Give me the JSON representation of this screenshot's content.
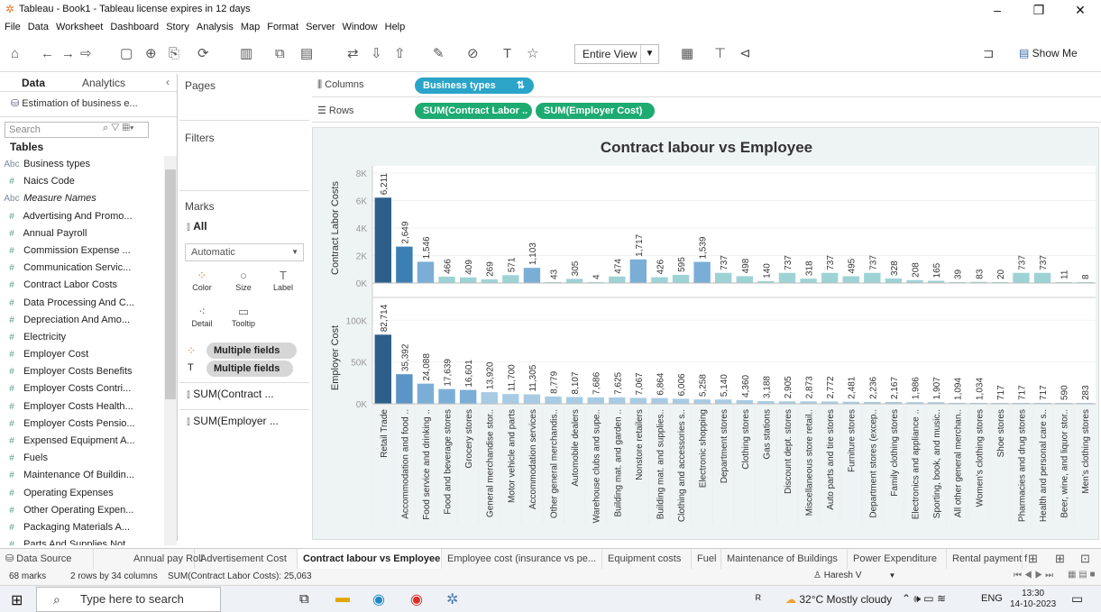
{
  "window": {
    "title": "Tableau - Book1 - Tableau license expires in 12 days"
  },
  "menu": [
    "File",
    "Data",
    "Worksheet",
    "Dashboard",
    "Story",
    "Analysis",
    "Map",
    "Format",
    "Server",
    "Window",
    "Help"
  ],
  "toolbar": {
    "fit": "Entire View",
    "show_me": "Show Me"
  },
  "data_pane": {
    "tab_data": "Data",
    "tab_analytics": "Analytics",
    "datasource": "Estimation of business e...",
    "search_placeholder": "Search",
    "tables_label": "Tables",
    "fields": [
      {
        "type": "Abc",
        "name": "Business types"
      },
      {
        "type": "#",
        "name": "Naics Code"
      },
      {
        "type": "Abc",
        "name": "Measure Names"
      },
      {
        "type": "#",
        "name": "Advertising And Promo..."
      },
      {
        "type": "#",
        "name": "Annual Payroll"
      },
      {
        "type": "#",
        "name": "Commission Expense ..."
      },
      {
        "type": "#",
        "name": "Communication Servic..."
      },
      {
        "type": "#",
        "name": "Contract Labor Costs"
      },
      {
        "type": "#",
        "name": "Data Processing And C..."
      },
      {
        "type": "#",
        "name": "Depreciation And Amo..."
      },
      {
        "type": "#",
        "name": "Electricity"
      },
      {
        "type": "#",
        "name": "Employer Cost"
      },
      {
        "type": "#",
        "name": "Employer Costs Benefits"
      },
      {
        "type": "#",
        "name": "Employer Costs Contri..."
      },
      {
        "type": "#",
        "name": "Employer Costs Health..."
      },
      {
        "type": "#",
        "name": "Employer Costs Pensio..."
      },
      {
        "type": "#",
        "name": "Expensed Equipment A..."
      },
      {
        "type": "#",
        "name": "Fuels"
      },
      {
        "type": "#",
        "name": "Maintenance Of Buildin..."
      },
      {
        "type": "#",
        "name": "Operating Expenses"
      },
      {
        "type": "#",
        "name": "Other Operating Expen..."
      },
      {
        "type": "#",
        "name": "Packaging Materials A..."
      },
      {
        "type": "#",
        "name": "Parts And Supplies Not..."
      }
    ]
  },
  "cards": {
    "pages": "Pages",
    "filters": "Filters",
    "marks": "Marks",
    "all": "All",
    "mark_type": "Automatic",
    "color": "Color",
    "size": "Size",
    "label": "Label",
    "detail": "Detail",
    "tooltip": "Tooltip",
    "multi1": "Multiple fields",
    "multi2": "Multiple fields",
    "sum1": "SUM(Contract ...",
    "sum2": "SUM(Employer ..."
  },
  "shelves": {
    "columns_label": "Columns",
    "rows_label": "Rows",
    "columns_pill": "Business types",
    "rows_pill1": "SUM(Contract Labor ..",
    "rows_pill2": "SUM(Employer Cost)"
  },
  "chart_data": {
    "type": "bar",
    "title": "Contract labour vs Employee",
    "categories": [
      "Retail Trade",
      "Accommodation and food ..",
      "Food service and drinking ..",
      "Food and beverage stores",
      "Grocery stores",
      "General merchandise stor..",
      "Motor vehicle and parts",
      "Accommodation services",
      "Other general merchandis..",
      "Automobile dealers",
      "Warehouse clubs and supe..",
      "Building mat. and garden ..",
      "Nonstore retailers",
      "Building mat. and supplies..",
      "Clothing and accessories s..",
      "Electronic shopping",
      "Department stores",
      "Clothing stores",
      "Gas stations",
      "Discount dept. stores",
      "Miscellaneous store retail..",
      "Auto parts and tire stores",
      "Furniture stores",
      "Department stores (excep..",
      "Family clothing stores",
      "Electronics and appliance ..",
      "Sporting, book, and music..",
      "All other general merchan..",
      "Women's clothing stores",
      "Shoe stores",
      "Pharmacies and drug stores",
      "Health and personal care s..",
      "Beer, wine, and liquor stor..",
      "Men's clothing stores"
    ],
    "series": [
      {
        "name": "Contract Labor Costs",
        "ylabel": "Contract Labor Costs",
        "ticks": [
          "8K",
          "6K",
          "4K",
          "2K",
          "0K"
        ],
        "ylim": [
          0,
          8000
        ],
        "values": [
          6211,
          2649,
          1546,
          466,
          409,
          269,
          571,
          1103,
          43,
          305,
          4,
          474,
          1717,
          426,
          595,
          1539,
          737,
          498,
          140,
          737,
          318,
          737,
          495,
          737,
          328,
          208,
          165,
          39,
          83,
          20,
          737,
          737,
          11,
          8
        ],
        "labels": [
          "6,211",
          "2,649",
          "1,546",
          "466",
          "409",
          "269",
          "571",
          "1,103",
          "43",
          "305",
          "4",
          "474",
          "1,717",
          "426",
          "595",
          "1,539",
          "737",
          "498",
          "140",
          "737",
          "318",
          "737",
          "495",
          "737",
          "328",
          "208",
          "165",
          "39",
          "83",
          "20",
          "737",
          "737",
          "11",
          "8"
        ]
      },
      {
        "name": "Employer Cost",
        "ylabel": "Employer Cost",
        "ticks": [
          "100K",
          "50K",
          "0K"
        ],
        "ylim": [
          0,
          110000
        ],
        "values": [
          82714,
          35392,
          24088,
          17639,
          16601,
          13920,
          11700,
          11305,
          8779,
          8107,
          7686,
          7625,
          7067,
          6864,
          6006,
          5258,
          5140,
          4360,
          3188,
          2905,
          2873,
          2772,
          2481,
          2236,
          2167,
          1986,
          1907,
          1094,
          1034,
          717,
          717,
          717,
          590,
          283
        ],
        "labels": [
          "82,714",
          "35,392",
          "24,088",
          "17,639",
          "16,601",
          "13,920",
          "11,700",
          "11,305",
          "8,779",
          "8,107",
          "7,686",
          "7,625",
          "7,067",
          "6,864",
          "6,006",
          "5,258",
          "5,140",
          "4,360",
          "3,188",
          "2,905",
          "2,873",
          "2,772",
          "2,481",
          "2,236",
          "2,167",
          "1,986",
          "1,907",
          "1,094",
          "1,034",
          "717",
          "717",
          "717",
          "590",
          "283"
        ]
      }
    ],
    "colors": {
      "dark": "#2e5f8a",
      "mid": "#7aaed6",
      "light": "#9ed3d6"
    }
  },
  "sheet_tabs": [
    "Data Source",
    "Annual pay Roll",
    "Advertisement Cost",
    "Contract labour vs Employee",
    "Employee cost (insurance vs pe...",
    "Equipment costs",
    "Fuel",
    "Maintenance of Buildings",
    "Power Expenditure",
    "Rental payment f"
  ],
  "status": {
    "marks": "68 marks",
    "dims": "2 rows by 34 columns",
    "sum": "SUM(Contract Labor Costs): 25,063",
    "user": "Haresh V"
  },
  "taskbar": {
    "search": "Type here to search",
    "weather": "32°C  Mostly cloudy",
    "lang": "ENG",
    "time": "13:30",
    "date": "14-10-2023"
  }
}
